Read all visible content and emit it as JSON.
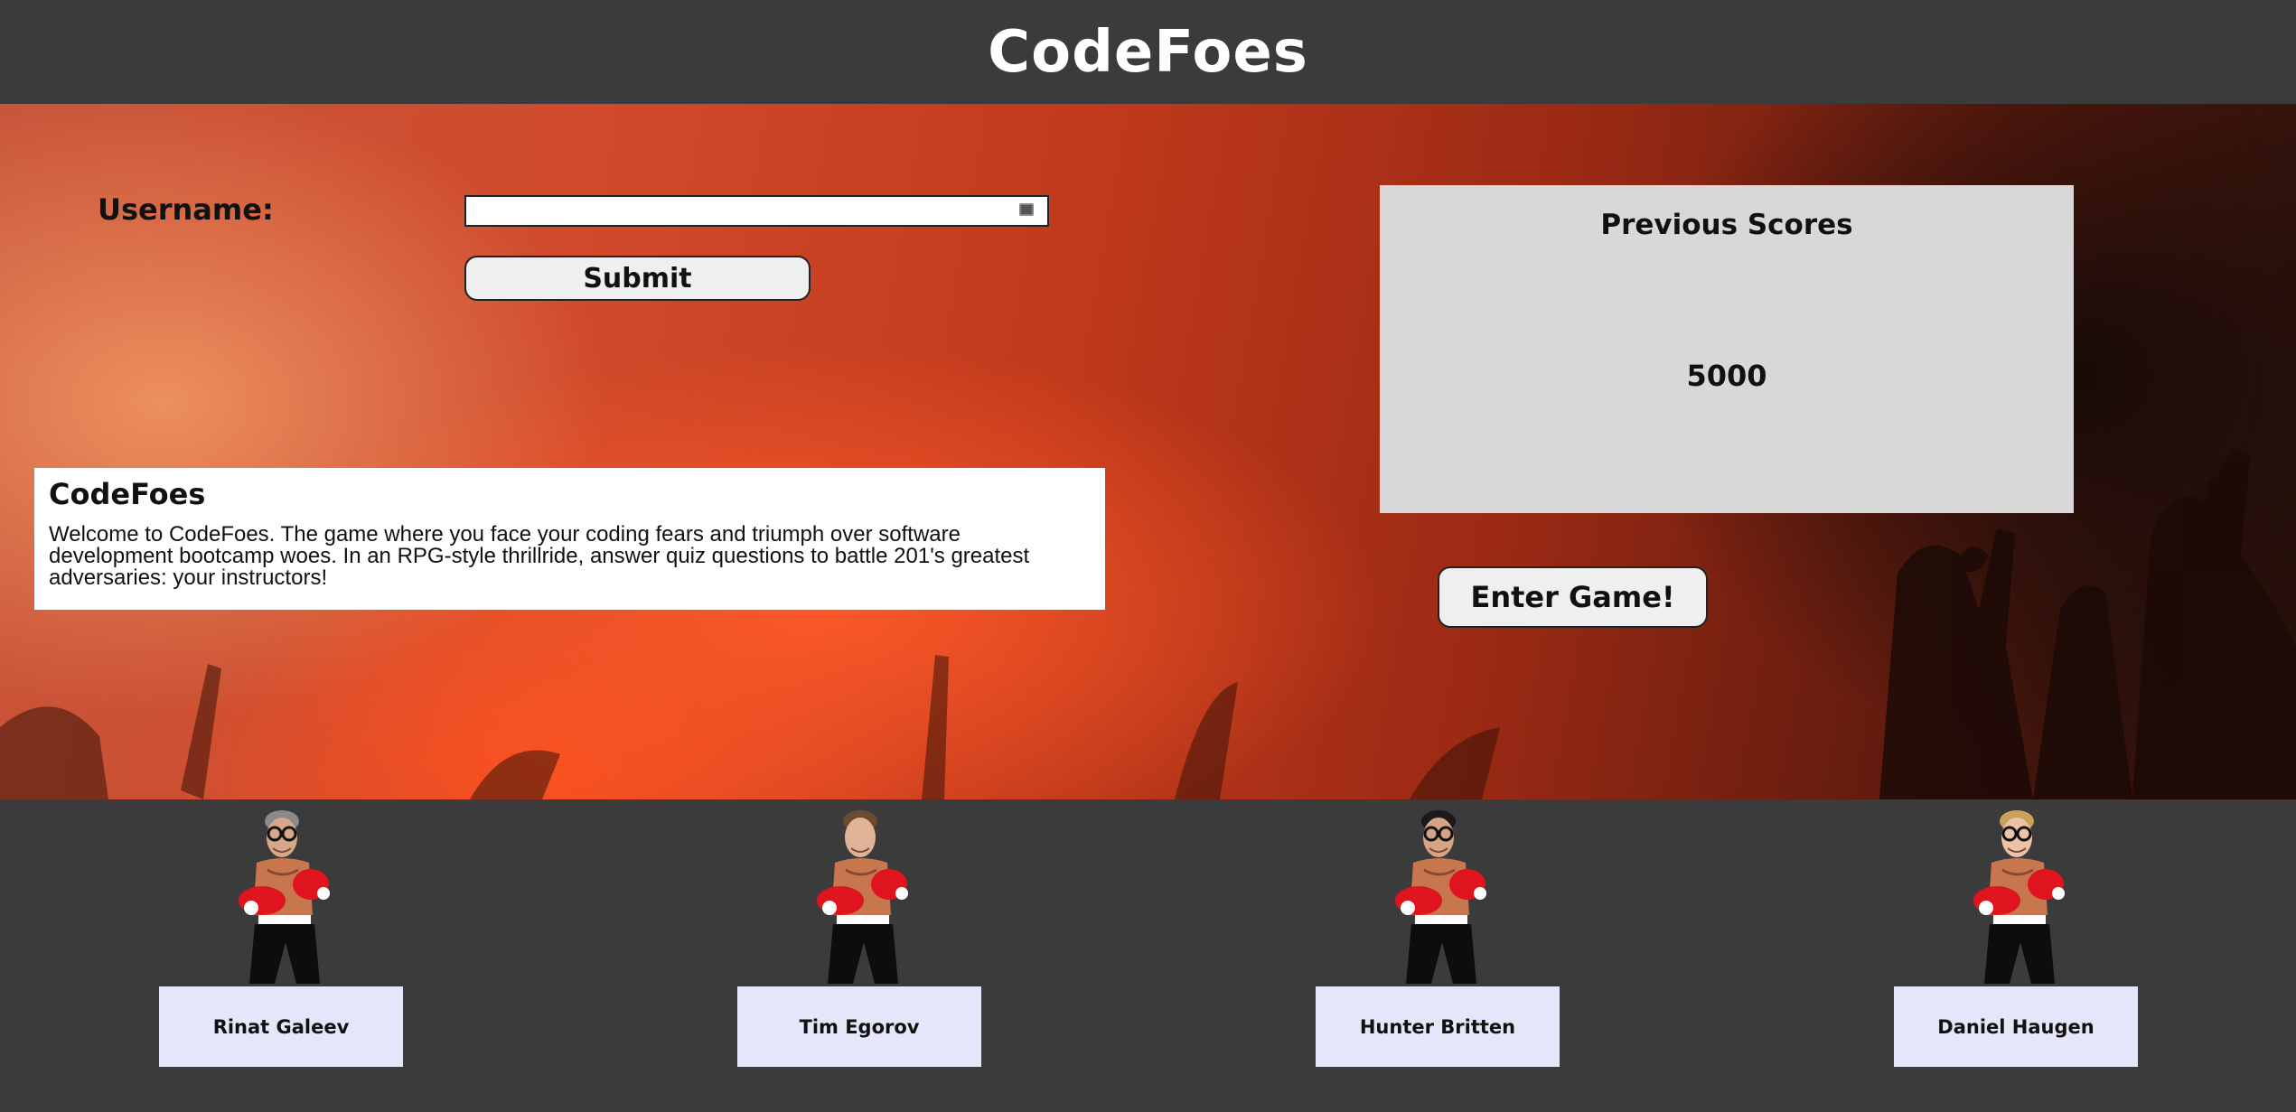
{
  "header": {
    "title": "CodeFoes"
  },
  "login": {
    "username_label": "Username:",
    "username_value": "",
    "username_placeholder": "",
    "submit_label": "Submit"
  },
  "intro": {
    "title": "CodeFoes",
    "text": "Welcome to CodeFoes. The game where you face your coding fears and triumph over software development bootcamp woes. In an RPG-style thrillride, answer quiz questions to battle 201's greatest adversaries: your instructors!"
  },
  "scores": {
    "title": "Previous Scores",
    "value": "5000"
  },
  "enter_button": {
    "label": "Enter Game!"
  },
  "instructors": [
    {
      "name": "Rinat Galeev",
      "hair": "#8a8a8a",
      "skin": "#d9a88a",
      "glasses": true
    },
    {
      "name": "Tim Egorov",
      "hair": "#6b4a2e",
      "skin": "#e0b296",
      "glasses": false
    },
    {
      "name": "Hunter Britten",
      "hair": "#1a1a1a",
      "skin": "#d6a383",
      "glasses": true
    },
    {
      "name": "Daniel Haugen",
      "hair": "#c9a15a",
      "skin": "#ecc3a8",
      "glasses": true
    }
  ],
  "colors": {
    "header_bg": "#3b3b3b",
    "score_panel_bg": "#d8d8d8",
    "name_card_bg": "#e6e6fa",
    "glove_red": "#e0141e"
  }
}
